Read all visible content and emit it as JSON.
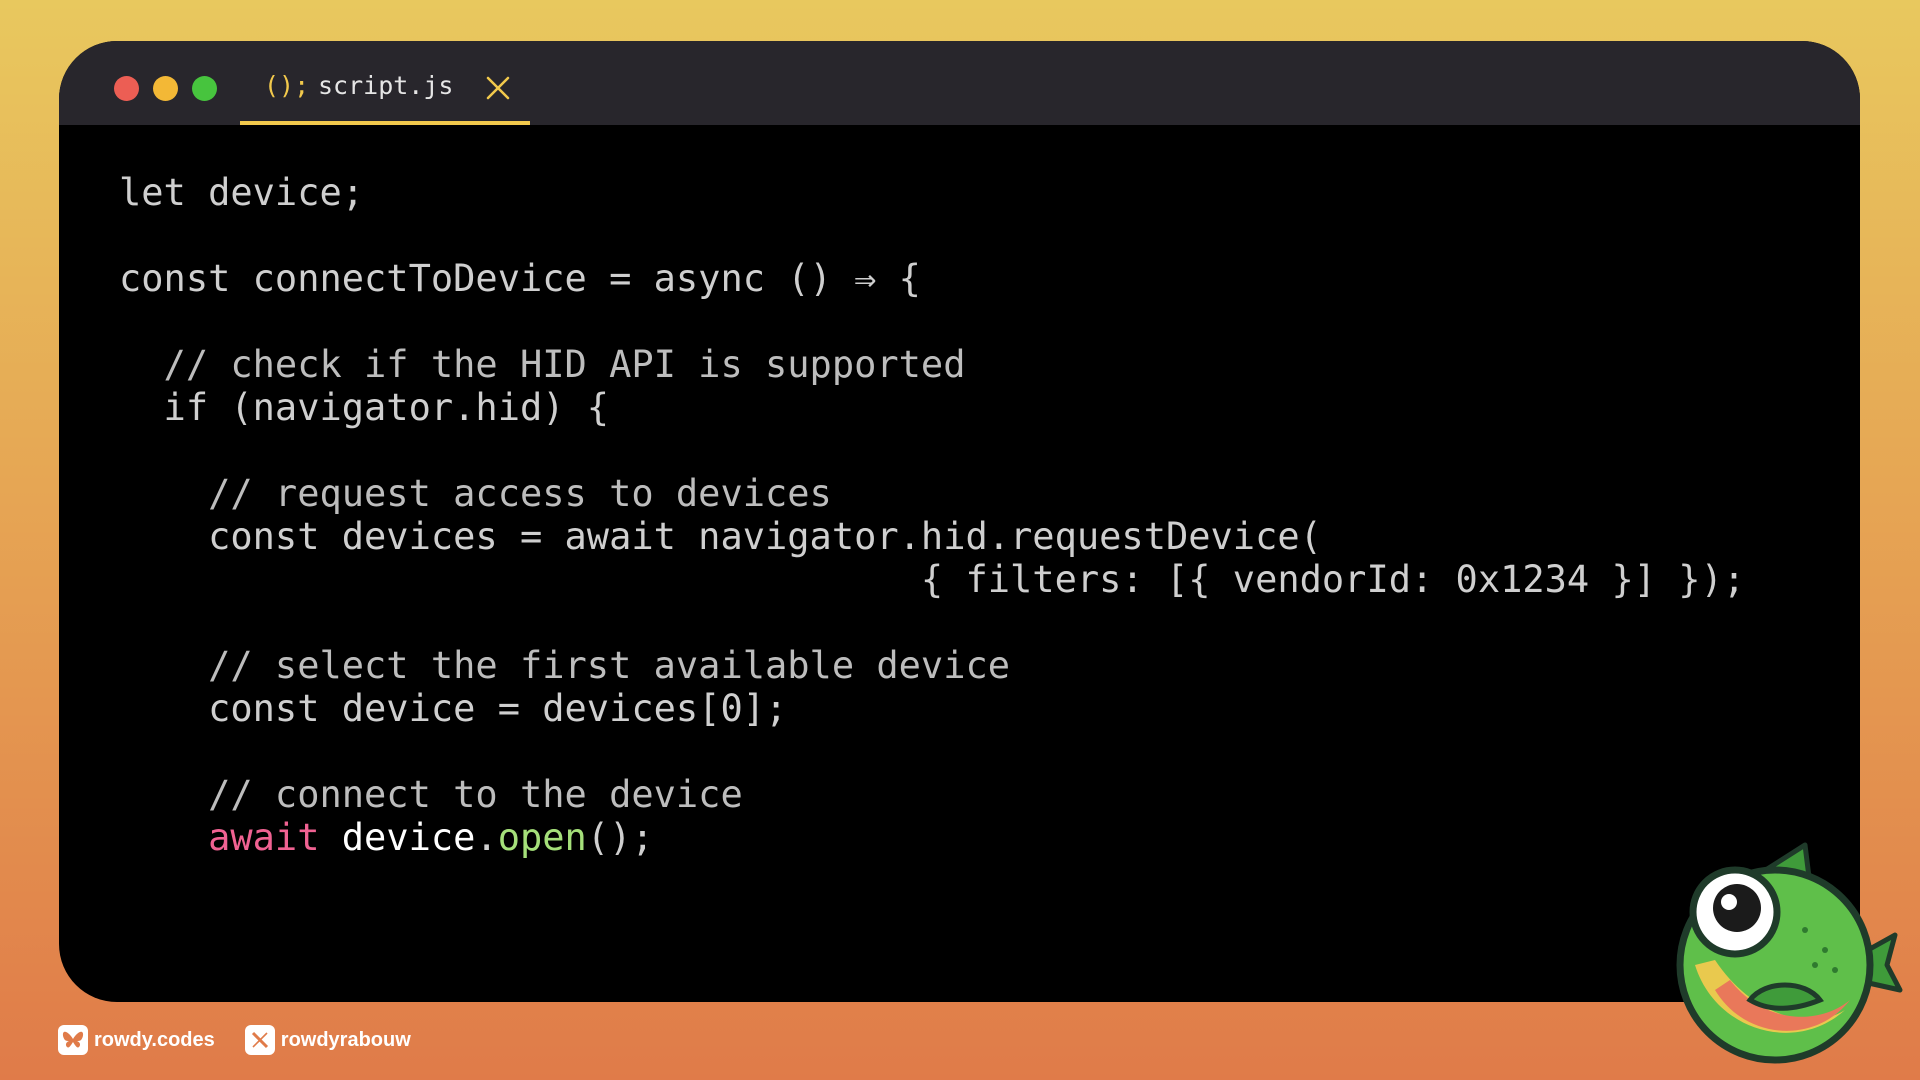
{
  "window": {
    "controls": [
      "close",
      "minimize",
      "maximize"
    ],
    "tab": {
      "icon_text": "();",
      "label": "script.js",
      "close_icon": "close-icon",
      "accent": "#f2c94c"
    }
  },
  "code": {
    "lines": [
      "let device;",
      "",
      "const connectToDevice = async () ⇒ {",
      "",
      "  // check if the HID API is supported",
      "  if (navigator.hid) {",
      "",
      "    // request access to devices",
      "    const devices = await navigator.hid.requestDevice(",
      "                                    { filters: [{ vendorId: 0x1234 }] });",
      "",
      "    // select the first available device",
      "    const device = devices[0];",
      "",
      "    // connect to the device"
    ],
    "last_line": {
      "indent": "    ",
      "keyword": "await",
      "object": "device",
      "dot": ".",
      "method": "open",
      "tail": "();"
    }
  },
  "footer": {
    "bluesky": {
      "icon": "butterfly-icon",
      "handle": "rowdy.codes"
    },
    "x": {
      "icon": "x-logo-icon",
      "handle": "rowdyrabouw"
    }
  },
  "mascot": "fish-mascot"
}
